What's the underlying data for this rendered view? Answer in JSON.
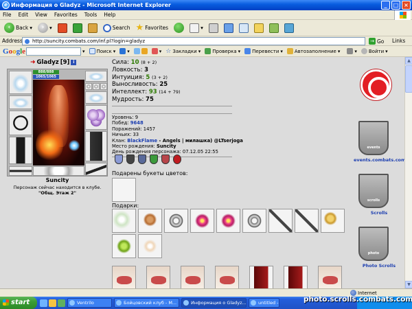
{
  "window": {
    "title": "Информация о Gladyz - Microsoft Internet Explorer"
  },
  "menu": [
    "File",
    "Edit",
    "View",
    "Favorites",
    "Tools",
    "Help"
  ],
  "toolbar": {
    "back": "Back",
    "search": "Search",
    "favorites": "Favorites"
  },
  "address": {
    "label": "Address",
    "url": "http://suncity.combats.com/inf.pl?login=gladyz",
    "go": "Go",
    "links": "Links"
  },
  "google_bar": {
    "logo": "Google",
    "search_btn": "Поиск",
    "bookmarks": "Закладки",
    "check": "Проверка",
    "translate": "Перевести",
    "autofill": "Автозаполнение",
    "signin": "Войти"
  },
  "character": {
    "name": "Gladyz",
    "level_tag": "[9]",
    "hp": "888/888",
    "mana": "1065/1065",
    "city": "Suncity",
    "status_line": "Персонаж сейчас находится в клубе.",
    "location": "\"Общ. Этаж 2\""
  },
  "stats": [
    {
      "label": "Сила: ",
      "value": "10",
      "extra": "(8 + 2)",
      "style": "green"
    },
    {
      "label": "Ловкость: ",
      "value": "3",
      "extra": "",
      "style": ""
    },
    {
      "label": "Интуиция: ",
      "value": "5",
      "extra": "(3 + 2)",
      "style": "green"
    },
    {
      "label": "Выносливость: ",
      "value": "25",
      "extra": "",
      "style": ""
    },
    {
      "label": "Интеллект: ",
      "value": "93",
      "extra": "(14 + 79)",
      "style": "green"
    },
    {
      "label": "Мудрость: ",
      "value": "75",
      "extra": "",
      "style": ""
    }
  ],
  "info": {
    "level_label": "Уровень: ",
    "level": "9",
    "wins_label": "Побед: ",
    "wins": "9648",
    "losses_label": "Поражений: ",
    "losses": "1457",
    "draws_label": "Ничьих: ",
    "draws": "33",
    "clan_label": "Клан: ",
    "clan": "BlackFlame",
    "clan_rest": " - Angels | милашка) @LTserjoga",
    "birthplace_label": "Место рождения: ",
    "birthplace": "Suncity",
    "birthday_label": "День рождения персонажа: ",
    "birthday": "07.12.05 22:55"
  },
  "bouquets_title": "Подарены букеты цветов:",
  "gifts_title": "Подарки:",
  "sidebar": {
    "events": "events.combats.com",
    "scrolls": "Scrolls",
    "photo": "Photo Scrolls",
    "shield1": "events",
    "shield2": "scrolls",
    "shield3": "photo"
  },
  "statusbar": {
    "zone": "Internet"
  },
  "taskbar": {
    "start": "start",
    "tasks": [
      "Ventrilo",
      "Бойцовский клуб - M...",
      "Информация о Gladyz...",
      "untitled - Paint"
    ]
  },
  "watermark": "photo.scrolls.combats.com"
}
